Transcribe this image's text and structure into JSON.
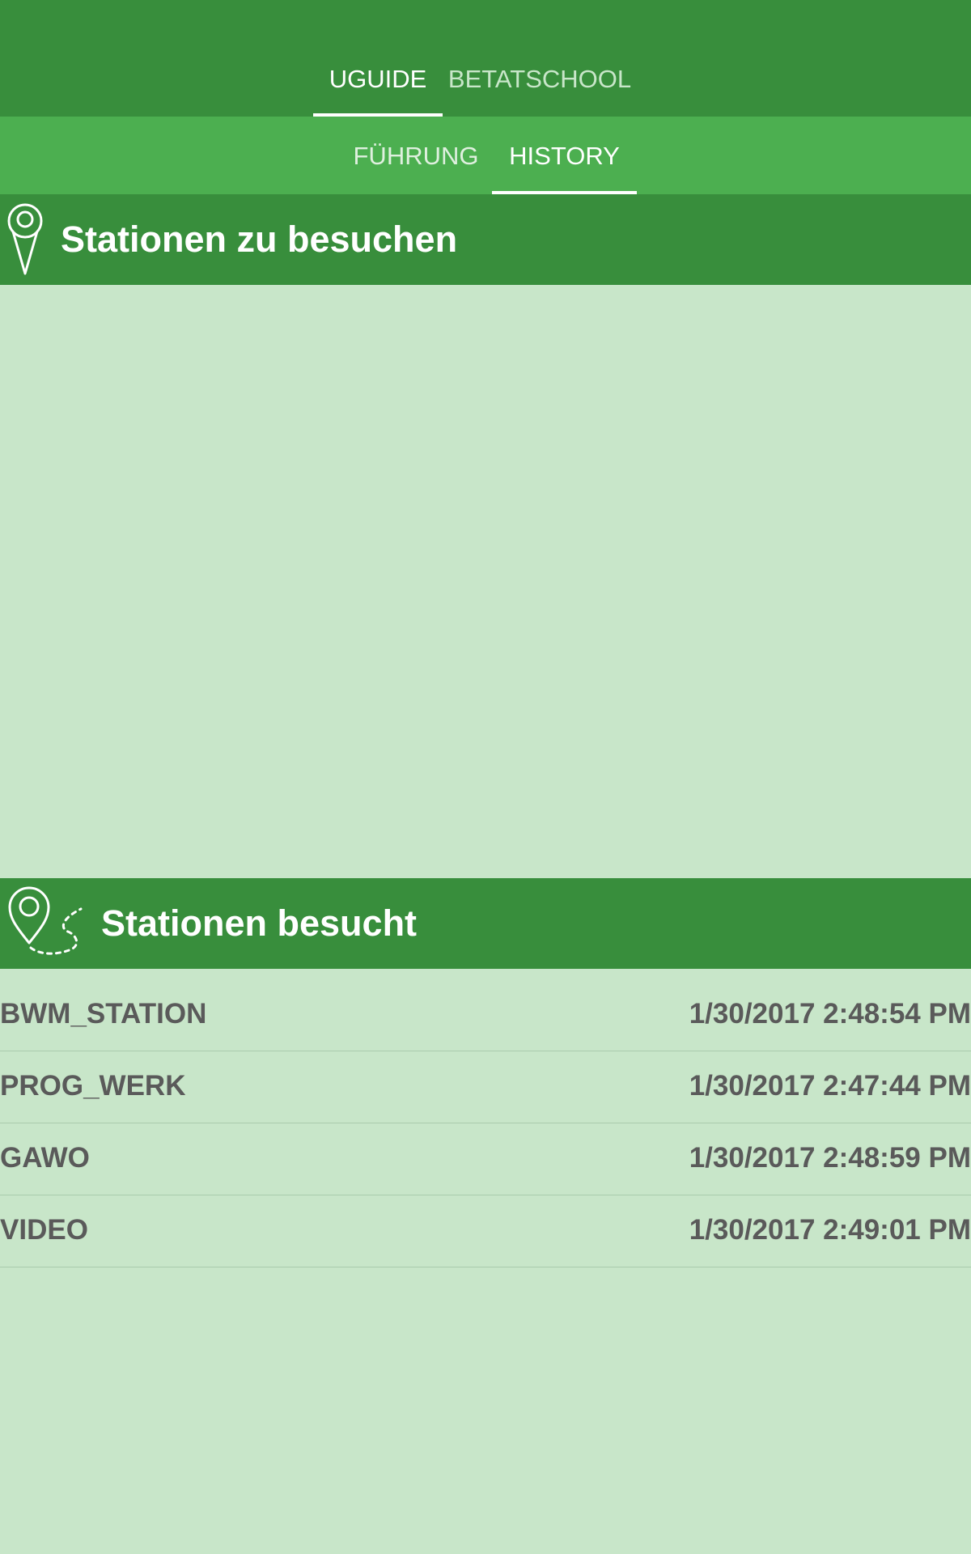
{
  "top_tabs": [
    {
      "label": "UGUIDE",
      "active": true
    },
    {
      "label": "BETATSCHOOL",
      "active": false
    }
  ],
  "sub_tabs": [
    {
      "label": "FÜHRUNG",
      "active": false
    },
    {
      "label": "HISTORY",
      "active": true
    }
  ],
  "to_visit": {
    "title": "Stationen zu besuchen",
    "icon": "map-pin-icon"
  },
  "visited": {
    "title": "Stationen besucht",
    "icon": "route-pin-icon",
    "rows": [
      {
        "name": "BWM_STATION",
        "time": "1/30/2017 2:48:54 PM"
      },
      {
        "name": "PROG_WERK",
        "time": "1/30/2017 2:47:44 PM"
      },
      {
        "name": "GAWO",
        "time": "1/30/2017 2:48:59 PM"
      },
      {
        "name": "VIDEO",
        "time": "1/30/2017 2:49:01 PM"
      }
    ]
  },
  "colors": {
    "primary_dark": "#388e3c",
    "primary": "#4caf50",
    "background": "#c8e6c9",
    "row_text": "#5a5a5a"
  }
}
